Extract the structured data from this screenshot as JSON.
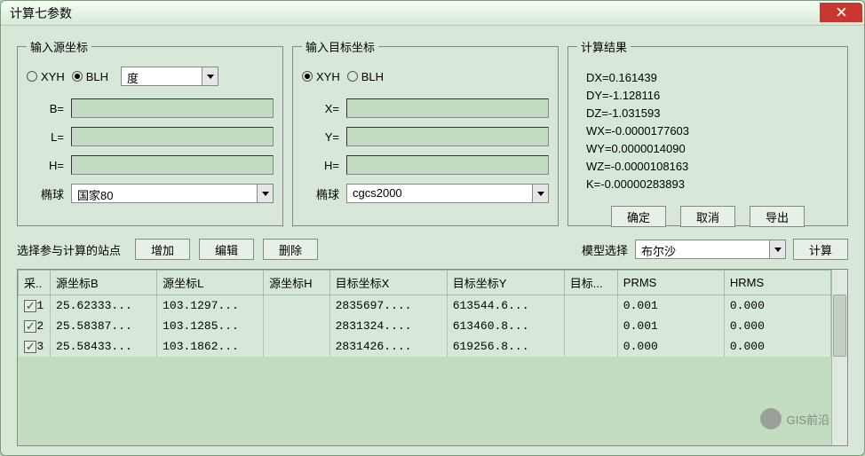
{
  "window": {
    "title": "计算七参数"
  },
  "src": {
    "legend": "输入源坐标",
    "xyh": "XYH",
    "blh": "BLH",
    "mode": "BLH",
    "unit": "度",
    "b_label": "B=",
    "l_label": "L=",
    "h_label": "H=",
    "b": "",
    "l": "",
    "h": "",
    "ellipsoid_label": "椭球",
    "ellipsoid": "国家80"
  },
  "tgt": {
    "legend": "输入目标坐标",
    "xyh": "XYH",
    "blh": "BLH",
    "mode": "XYH",
    "x_label": "X=",
    "y_label": "Y=",
    "h_label": "H=",
    "x": "",
    "y": "",
    "h": "",
    "ellipsoid_label": "椭球",
    "ellipsoid": "cgcs2000"
  },
  "result": {
    "legend": "计算结果",
    "dx": "DX=0.161439",
    "dy": "DY=-1.128116",
    "dz": "DZ=-1.031593",
    "wx": "WX=-0.0000177603",
    "wy": "WY=0.0000014090",
    "wz": "WZ=-0.0000108163",
    "k": "K=-0.00000283893",
    "ok": "确定",
    "cancel": "取消",
    "export": "导出"
  },
  "mid": {
    "select_label": "选择参与计算的站点",
    "add": "增加",
    "edit": "编辑",
    "delete": "删除",
    "model_label": "模型选择",
    "model": "布尔沙",
    "compute": "计算"
  },
  "table": {
    "headers": {
      "c0": "采..",
      "c1": "源坐标B",
      "c2": "源坐标L",
      "c3": "源坐标H",
      "c4": "目标坐标X",
      "c5": "目标坐标Y",
      "c6": "目标...",
      "c7": "PRMS",
      "c8": "HRMS"
    },
    "rows": [
      {
        "chk": true,
        "idx": "1",
        "b": "25.62333...",
        "l": "103.1297...",
        "h": "",
        "tx": "2835697....",
        "ty": "613544.6...",
        "th": "",
        "prms": "0.001",
        "hrms": "0.000"
      },
      {
        "chk": true,
        "idx": "2",
        "b": "25.58387...",
        "l": "103.1285...",
        "h": "",
        "tx": "2831324....",
        "ty": "613460.8...",
        "th": "",
        "prms": "0.001",
        "hrms": "0.000"
      },
      {
        "chk": true,
        "idx": "3",
        "b": "25.58433...",
        "l": "103.1862...",
        "h": "",
        "tx": "2831426....",
        "ty": "619256.8...",
        "th": "",
        "prms": "0.000",
        "hrms": "0.000"
      }
    ]
  },
  "watermark": "GIS前沿"
}
